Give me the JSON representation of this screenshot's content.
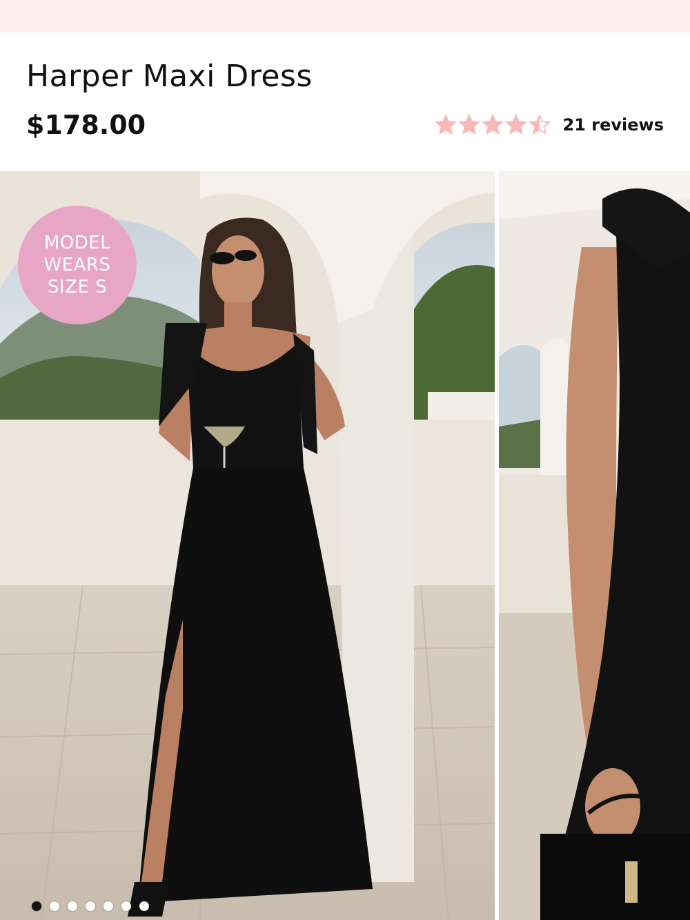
{
  "product": {
    "title": "Harper Maxi Dress",
    "price": "$178.00",
    "rating": 4.5,
    "rating_max": 5,
    "reviews_label": "21 reviews"
  },
  "gallery": {
    "badge_lines": [
      "MODEL",
      "WEARS",
      "SIZE S"
    ],
    "slide_count": 7,
    "active_slide": 0
  },
  "colors": {
    "banner": "#fdeeee",
    "star": "#f7b8b8",
    "badge": "#e8a6c7",
    "dress": "#111111"
  }
}
